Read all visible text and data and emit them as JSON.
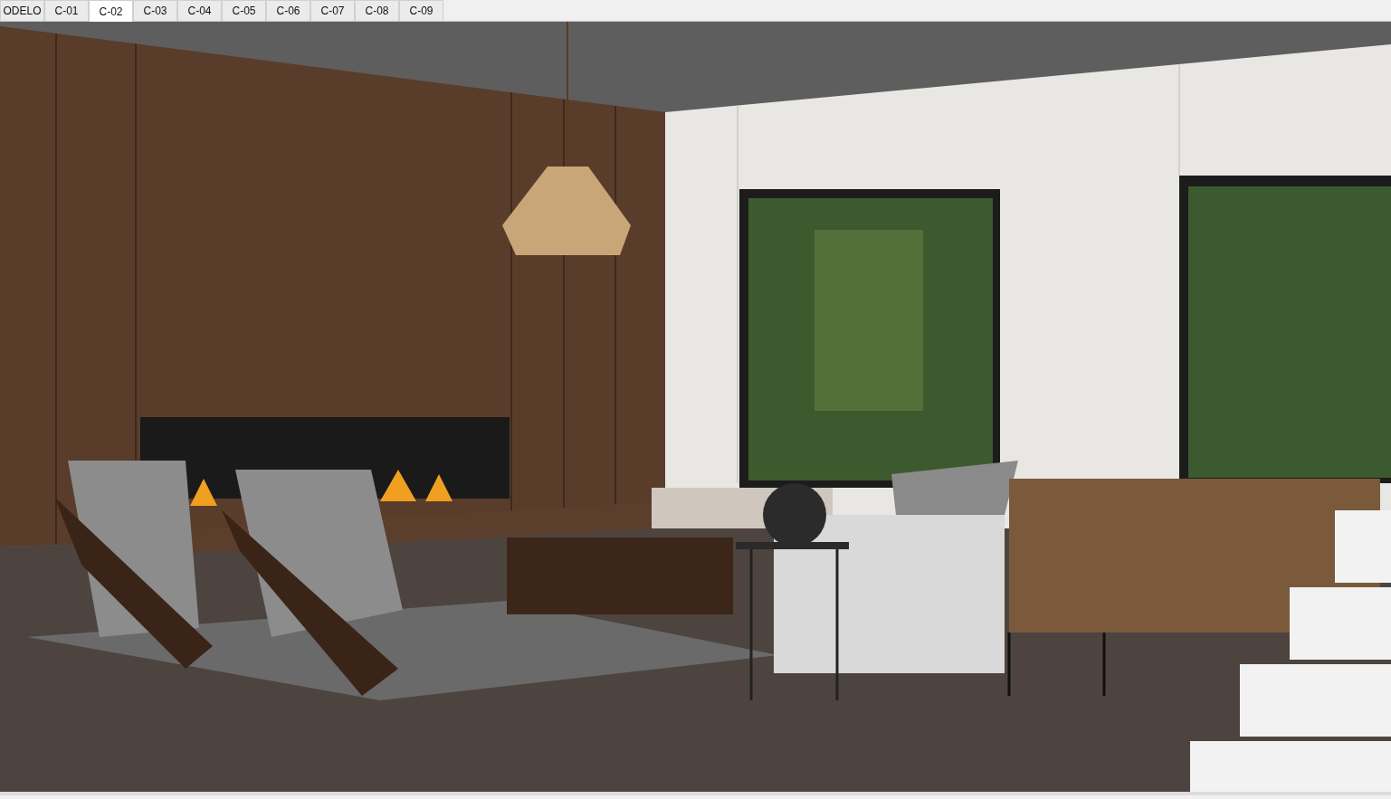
{
  "scene_tabs": [
    {
      "label": "ODELO",
      "selected": false
    },
    {
      "label": "C-01",
      "selected": false
    },
    {
      "label": "C-02",
      "selected": true
    },
    {
      "label": "C-03",
      "selected": false
    },
    {
      "label": "C-04",
      "selected": false
    },
    {
      "label": "C-05",
      "selected": false
    },
    {
      "label": "C-06",
      "selected": false
    },
    {
      "label": "C-07",
      "selected": false
    },
    {
      "label": "C-08",
      "selected": false
    },
    {
      "label": "C-09",
      "selected": false
    }
  ]
}
